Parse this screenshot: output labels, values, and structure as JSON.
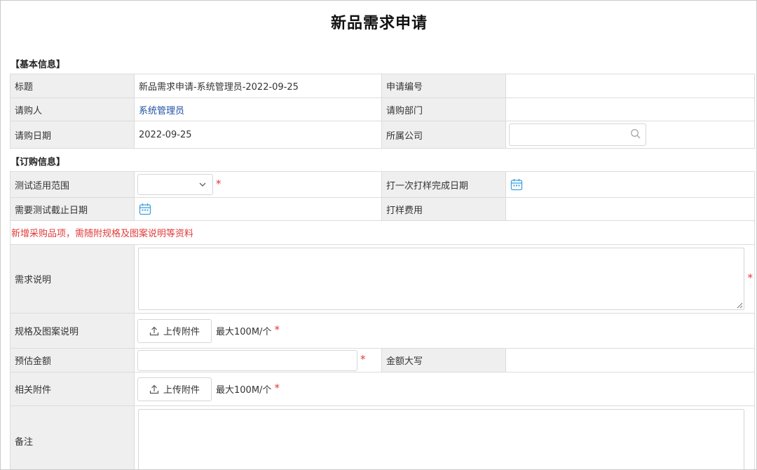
{
  "page_title": "新品需求申请",
  "sections": {
    "basic": "【基本信息】",
    "order": "【订购信息】"
  },
  "basic": {
    "title_label": "标题",
    "title_value": "新品需求申请-系统管理员-2022-09-25",
    "app_no_label": "申请编号",
    "app_no_value": "",
    "requester_label": "请购人",
    "requester_value": "系统管理员",
    "dept_label": "请购部门",
    "dept_value": "",
    "date_label": "请购日期",
    "date_value": "2022-09-25",
    "company_label": "所属公司",
    "company_value": ""
  },
  "order": {
    "scope_label": "测试适用范围",
    "scope_selected": "",
    "sample_done_label": "打一次打样完成日期",
    "test_deadline_label": "需要测试截止日期",
    "sample_fee_label": "打样费用",
    "sample_fee_value": "",
    "notice": "新增采购品项，需随附规格及图案说明等资料",
    "demand_label": "需求说明",
    "spec_label": "规格及图案说明",
    "upload_label": "上传附件",
    "upload_hint": "最大100M/个",
    "amount_label": "预估金额",
    "amount_value": "",
    "amount_upper_label": "金额大写",
    "amount_upper_value": "",
    "attach_label": "相关附件",
    "remark_label": "备注"
  },
  "required_mark": "*",
  "icons": {
    "chevron": "chevron-down-icon",
    "search": "search-icon",
    "calendar": "calendar-icon",
    "upload": "upload-icon"
  },
  "colors": {
    "label_bg": "#efefef",
    "required": "#e03b3b",
    "link": "#1f4fa3",
    "calendar": "#3fa0e0"
  }
}
